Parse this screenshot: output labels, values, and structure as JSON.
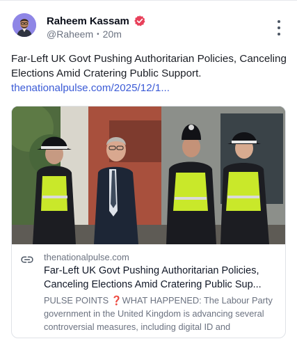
{
  "author": {
    "display_name": "Raheem Kassam",
    "handle": "@Raheem",
    "separator": "•",
    "time_ago": "20m",
    "verified_color": "#e8405a",
    "avatar_bg": "#8f86e6"
  },
  "post": {
    "text": "Far-Left UK Govt Pushing Authoritarian Policies, Canceling Elections Amid Cratering Public Support.",
    "link_text": "thenationalpulse.com/2025/12/1..."
  },
  "card": {
    "domain": "thenationalpulse.com",
    "title": "Far-Left UK Govt Pushing Authoritarian Policies, Canceling Elections Amid Cratering Public Sup...",
    "description": "PULSE POINTS ❓WHAT HAPPENED: The Labour Party government in the United Kingdom is advancing several controversial measures, including digital ID and"
  },
  "colors": {
    "link": "#3b5bd6",
    "muted": "#6b7280",
    "hi_vis": "#c9e82a"
  },
  "icons": {
    "menu": "more-vertical-icon",
    "card_link": "link-icon",
    "verified": "verified-badge-icon"
  }
}
